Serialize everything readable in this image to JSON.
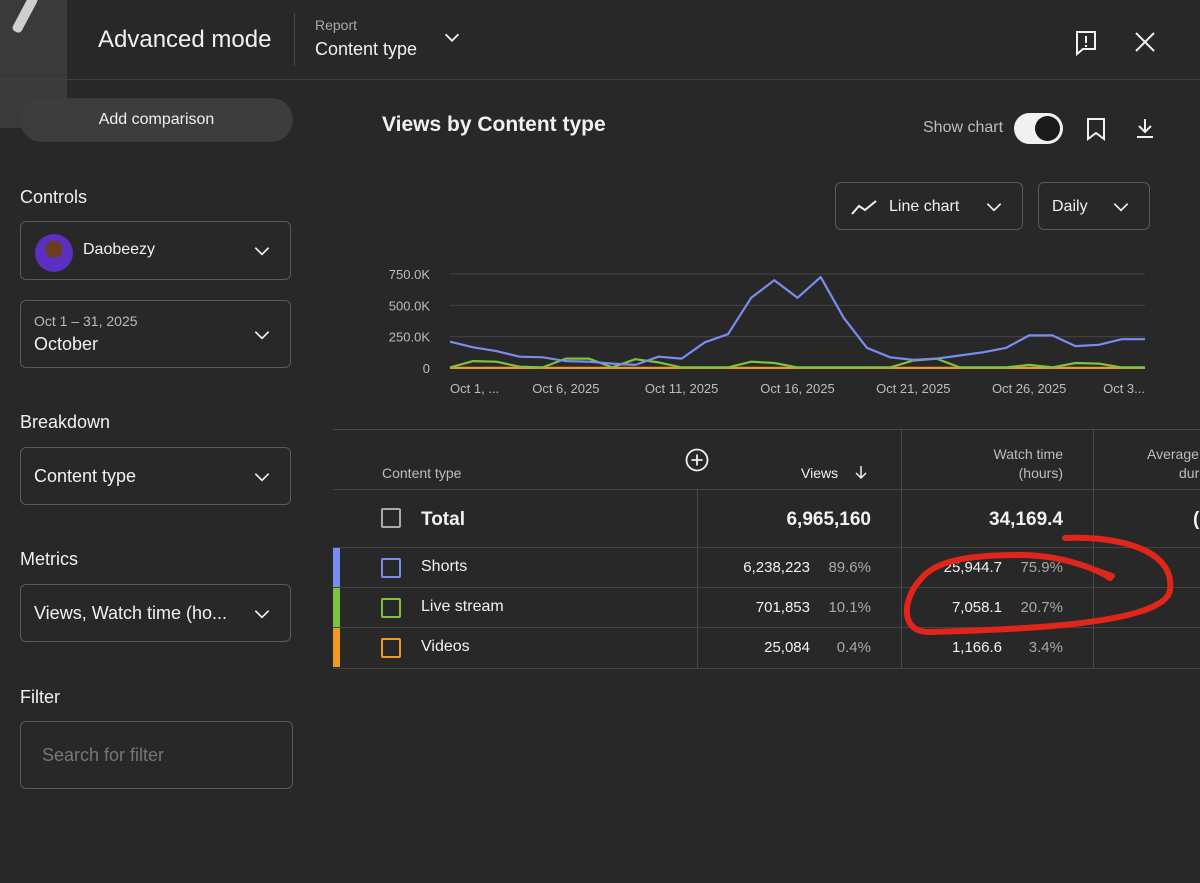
{
  "header": {
    "mode_title": "Advanced mode",
    "report_label": "Report",
    "report_value": "Content type"
  },
  "sidebar": {
    "add_comparison": "Add comparison",
    "controls_label": "Controls",
    "channel_name": "Daobeezy",
    "date_range": "Oct 1 – 31, 2025",
    "date_period": "October",
    "breakdown_label": "Breakdown",
    "breakdown_value": "Content type",
    "metrics_label": "Metrics",
    "metrics_value": "Views, Watch time (ho...",
    "filter_label": "Filter",
    "filter_placeholder": "Search for filter"
  },
  "chart_panel": {
    "title": "Views by Content type",
    "show_chart_label": "Show chart",
    "show_chart_on": true,
    "chart_type_label": "Line chart",
    "interval_label": "Daily"
  },
  "chart_data": {
    "type": "line",
    "ylim": [
      0,
      750000
    ],
    "y_ticks": [
      "750.0K",
      "500.0K",
      "250.0K",
      "0"
    ],
    "x_ticks": [
      "Oct 1, ...",
      "Oct 6, 2025",
      "Oct 11, 2025",
      "Oct 16, 2025",
      "Oct 21, 2025",
      "Oct 26, 2025",
      "Oct 3..."
    ],
    "x": [
      1,
      2,
      3,
      4,
      5,
      6,
      7,
      8,
      9,
      10,
      11,
      12,
      13,
      14,
      15,
      16,
      17,
      18,
      19,
      20,
      21,
      22,
      23,
      24,
      25,
      26,
      27,
      28,
      29,
      30,
      31
    ],
    "series": [
      {
        "name": "Shorts",
        "color": "#7b8cf0",
        "values": [
          210000,
          165000,
          135000,
          90000,
          85000,
          55000,
          50000,
          35000,
          25000,
          90000,
          75000,
          205000,
          270000,
          560000,
          700000,
          560000,
          725000,
          400000,
          160000,
          85000,
          65000,
          75000,
          100000,
          125000,
          160000,
          260000,
          260000,
          175000,
          185000,
          230000,
          230000
        ]
      },
      {
        "name": "Live stream",
        "color": "#7dc241",
        "values": [
          5000,
          55000,
          50000,
          10000,
          5000,
          75000,
          75000,
          5000,
          70000,
          45000,
          5000,
          5000,
          5000,
          50000,
          40000,
          5000,
          5000,
          5000,
          5000,
          5000,
          60000,
          75000,
          5000,
          5000,
          5000,
          25000,
          5000,
          40000,
          35000,
          5000,
          5000
        ]
      },
      {
        "name": "Videos",
        "color": "#f09a1f",
        "values": [
          1000,
          1000,
          1000,
          1000,
          1000,
          1000,
          1000,
          1000,
          1000,
          1000,
          1000,
          1000,
          1000,
          1000,
          1000,
          1000,
          1000,
          1000,
          1000,
          1000,
          1000,
          1000,
          1000,
          1000,
          1000,
          1000,
          1000,
          1000,
          1000,
          1000,
          1000
        ]
      }
    ]
  },
  "table": {
    "headers": {
      "content_type": "Content type",
      "views": "Views",
      "watch_time_line1": "Watch time",
      "watch_time_line2": "(hours)",
      "avg_line1": "Average",
      "avg_line2": "dur"
    },
    "total": {
      "label": "Total",
      "views": "6,965,160",
      "watch_time": "34,169.4",
      "avg_partial": "("
    },
    "rows": [
      {
        "label": "Shorts",
        "color": "#7b8cf0",
        "views": "6,238,223",
        "views_pct": "89.6%",
        "watch": "25,944.7",
        "watch_pct": "75.9%"
      },
      {
        "label": "Live stream",
        "color": "#7dc241",
        "views": "701,853",
        "views_pct": "10.1%",
        "watch": "7,058.1",
        "watch_pct": "20.7%"
      },
      {
        "label": "Videos",
        "color": "#f09a1f",
        "views": "25,084",
        "views_pct": "0.4%",
        "watch": "1,166.6",
        "watch_pct": "3.4%"
      }
    ]
  },
  "colors": {
    "annotation": "#e0261b",
    "background": "#282828"
  }
}
